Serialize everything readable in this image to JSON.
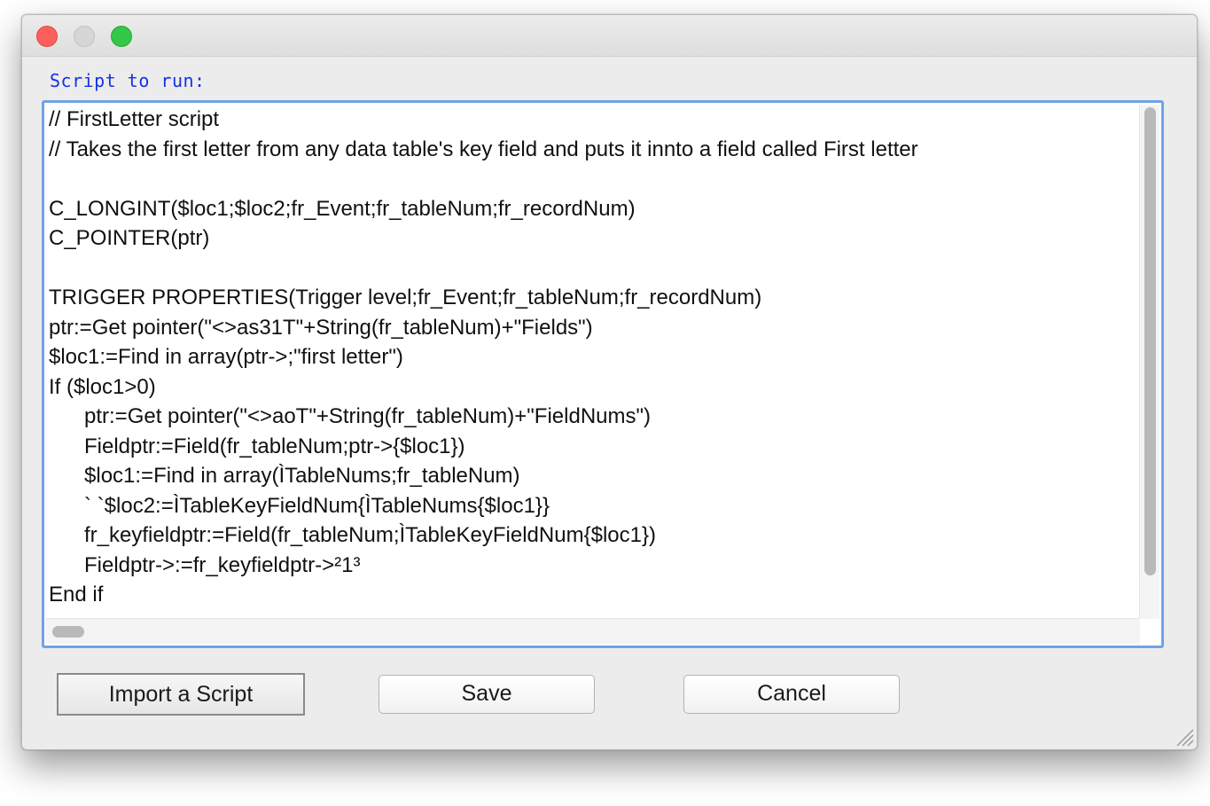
{
  "window": {
    "buttons": [
      "close",
      "minimize",
      "zoom"
    ]
  },
  "label": "Script to run:",
  "editor": {
    "lines": [
      "// FirstLetter script",
      "// Takes the first letter from any data table's key field and puts it innto a field called First letter",
      "",
      "C_LONGINT($loc1;$loc2;fr_Event;fr_tableNum;fr_recordNum)",
      "C_POINTER(ptr)",
      "",
      "TRIGGER PROPERTIES(Trigger level;fr_Event;fr_tableNum;fr_recordNum)",
      "ptr:=Get pointer(\"<>as31T\"+String(fr_tableNum)+\"Fields\")",
      "$loc1:=Find in array(ptr->;\"first letter\")",
      "If ($loc1>0)",
      "      ptr:=Get pointer(\"<>aoT\"+String(fr_tableNum)+\"FieldNums\")",
      "      Fieldptr:=Field(fr_tableNum;ptr->{$loc1})",
      "      $loc1:=Find in array(ÌTableNums;fr_tableNum)",
      "      ` `$loc2:=ÌTableKeyFieldNum{ÌTableNums{$loc1}}",
      "      fr_keyfieldptr:=Field(fr_tableNum;ÌTableKeyFieldNum{$loc1})",
      "      Fieldptr->:=fr_keyfieldptr->²1³",
      "End if"
    ]
  },
  "buttons": {
    "import": "Import a Script",
    "save": "Save",
    "cancel": "Cancel"
  },
  "colors": {
    "label": "#1432e6",
    "focus_ring": "#6fa3e6",
    "close": "#fc605c",
    "zoom": "#34c748",
    "minimize_inactive": "#d6d6d6"
  }
}
